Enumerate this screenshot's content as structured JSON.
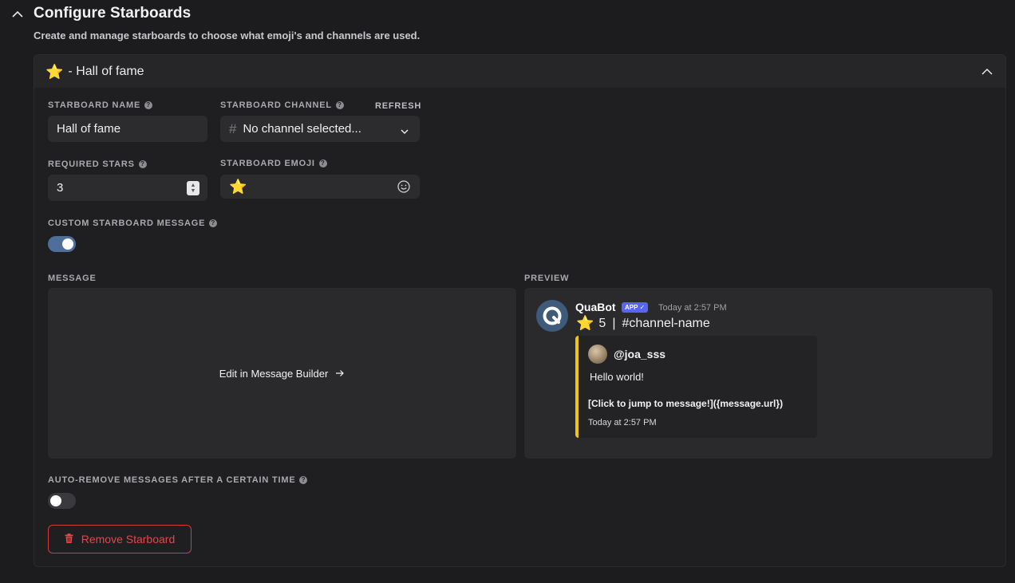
{
  "section": {
    "title": "Configure Starboards",
    "subtitle": "Create and manage starboards to choose what emoji's and channels are used."
  },
  "starboard": {
    "emoji": "⭐",
    "title": "- Hall of fame",
    "name_label": "STARBOARD NAME",
    "name_value": "Hall of fame",
    "channel_label": "STARBOARD CHANNEL",
    "refresh_label": "REFRESH",
    "channel_placeholder": "No channel selected...",
    "required_stars_label": "REQUIRED STARS",
    "required_stars_value": "3",
    "emoji_label": "STARBOARD EMOJI",
    "emoji_value": "⭐",
    "custom_message_label": "CUSTOM STARBOARD MESSAGE",
    "custom_message_enabled": true,
    "message_label": "MESSAGE",
    "builder_link": "Edit in Message Builder",
    "preview_label": "PREVIEW",
    "auto_remove_label": "AUTO-REMOVE MESSAGES AFTER A CERTAIN TIME",
    "auto_remove_enabled": false,
    "remove_button": "Remove Starboard"
  },
  "preview": {
    "bot_name": "QuaBot",
    "badge": "APP",
    "timestamp": "Today at 2:57 PM",
    "star_emoji": "⭐",
    "star_count": "5",
    "separator": "|",
    "channel": "#channel-name",
    "embed": {
      "author": "@joa_sss",
      "description": "Hello world!",
      "link": "[Click to jump to message!]({message.url})",
      "footer": "Today at 2:57 PM"
    }
  },
  "colors": {
    "accent_toggle": "#4e6f9a",
    "embed_border": "#f0c419",
    "danger": "#d13b3b",
    "badge": "#5865f2"
  }
}
